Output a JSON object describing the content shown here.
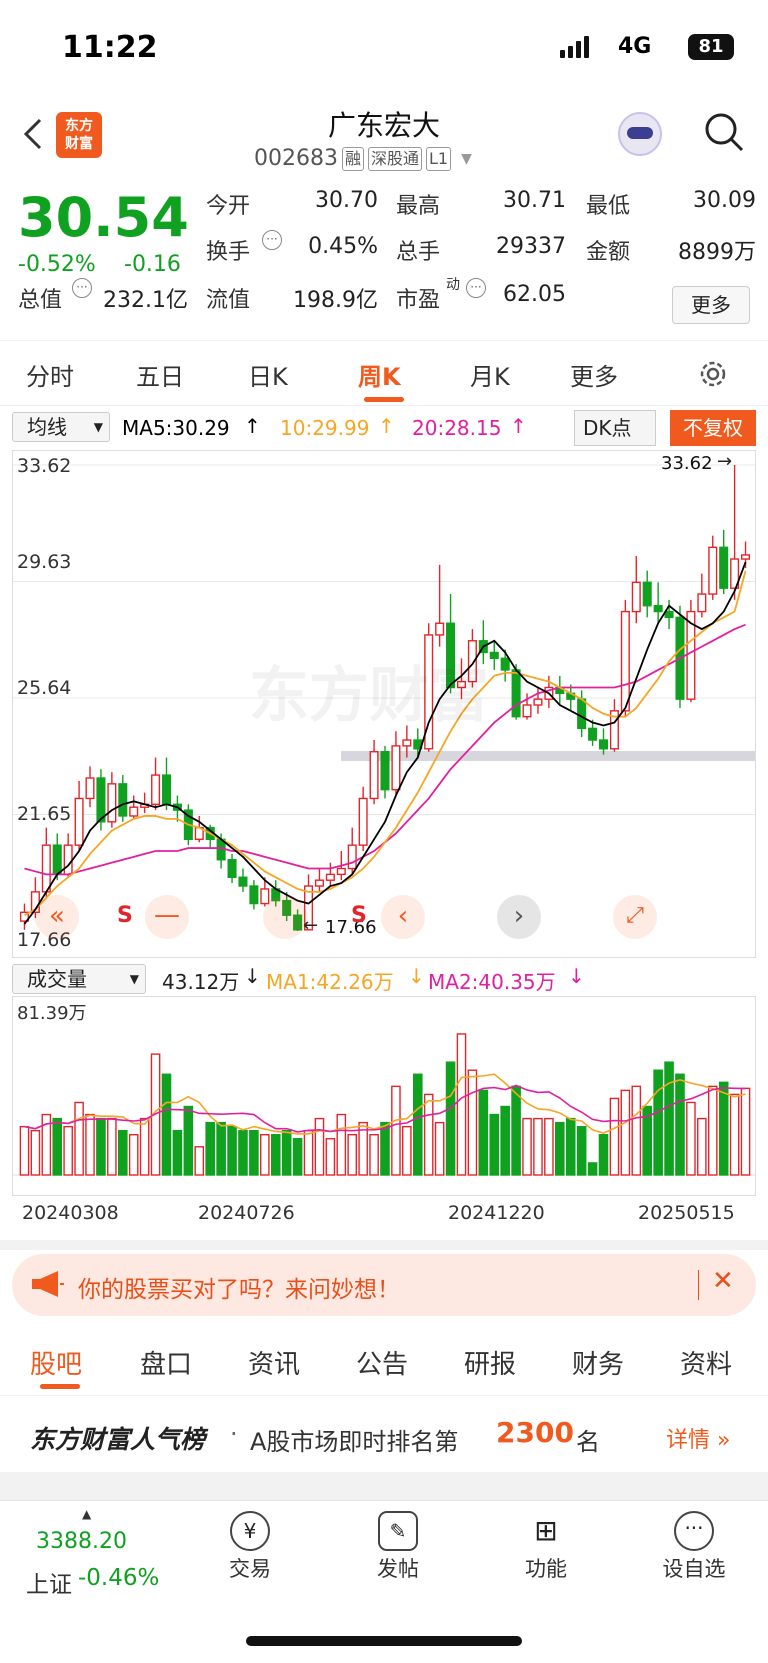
{
  "status": {
    "time": "11:22",
    "network": "4G",
    "battery": "81"
  },
  "header": {
    "logo": "东方财富",
    "title": "广东宏大",
    "code": "002683",
    "tags": [
      "融",
      "深股通",
      "L1"
    ]
  },
  "quote": {
    "price": "30.54",
    "change_pct": "-0.52%",
    "change": "-0.16",
    "open_label": "今开",
    "open": "30.70",
    "high_label": "最高",
    "high": "30.71",
    "low_label": "最低",
    "low": "30.09",
    "turnover_label": "换手",
    "turnover": "0.45%",
    "volume_label": "总手",
    "volume": "29337",
    "amount_label": "金额",
    "amount": "8899万",
    "mcap_label": "总值",
    "mcap": "232.1亿",
    "float_label": "流值",
    "float": "198.9亿",
    "pe_label": "市盈",
    "pe_sup": "动",
    "pe": "62.05",
    "more": "更多"
  },
  "tabs": [
    "分时",
    "五日",
    "日K",
    "周K",
    "月K",
    "更多"
  ],
  "chart_toolbar": {
    "select": "均线",
    "ma5": "MA5:30.29",
    "ma10": "10:29.99",
    "ma20": "20:28.15",
    "dk": "DK点",
    "fuquan": "不复权"
  },
  "kchart": {
    "y_labels": [
      "33.62",
      "29.63",
      "25.64",
      "21.65",
      "17.66"
    ],
    "max_mark": "33.62",
    "min_mark": "17.66",
    "watermark": "东方财富",
    "signals": [
      "S",
      "S"
    ]
  },
  "vol_toolbar": {
    "select": "成交量",
    "vol": "43.12万",
    "ma1": "MA1:42.26万",
    "ma2": "MA2:40.35万"
  },
  "vchart": {
    "max_label": "81.39万"
  },
  "dates": [
    "20240308",
    "20240726",
    "20241220",
    "20250515"
  ],
  "banner": {
    "text": "你的股票买对了吗？来问妙想！"
  },
  "bottom_tabs": [
    "股吧",
    "盘口",
    "资讯",
    "公告",
    "研报",
    "财务",
    "资料"
  ],
  "rank": {
    "brand": "东方财富人气榜",
    "text": "A股市场即时排名第",
    "num": "2300",
    "suffix": "名",
    "detail": "详情"
  },
  "bottom_nav": {
    "index_value": "3388.20",
    "index_name": "上证",
    "index_change": "-0.46%",
    "items": [
      "交易",
      "发帖",
      "功能",
      "设自选"
    ]
  },
  "colors": {
    "accent": "#f05a1e",
    "up": "#e3242b",
    "down": "#11a121",
    "ma5": "#000000",
    "ma10": "#f5a623",
    "ma20": "#e020a0"
  },
  "chart_data": {
    "type": "candlestick",
    "ylim": [
      17.66,
      33.62
    ],
    "candles": [
      [
        18.0,
        18.3,
        17.7,
        18.6
      ],
      [
        18.3,
        19.0,
        18.1,
        19.5
      ],
      [
        19.0,
        20.6,
        18.8,
        21.2
      ],
      [
        20.6,
        19.6,
        19.4,
        21.0
      ],
      [
        19.6,
        20.6,
        19.5,
        21.0
      ],
      [
        20.6,
        22.2,
        20.4,
        22.8
      ],
      [
        22.2,
        22.9,
        21.9,
        23.3
      ],
      [
        22.9,
        21.4,
        21.1,
        23.2
      ],
      [
        21.4,
        22.7,
        21.2,
        23.1
      ],
      [
        22.7,
        21.6,
        21.4,
        23.0
      ],
      [
        21.6,
        21.9,
        21.5,
        22.3
      ],
      [
        21.9,
        22.0,
        21.7,
        22.4
      ],
      [
        22.0,
        23.0,
        21.8,
        23.6
      ],
      [
        23.0,
        22.0,
        21.8,
        23.6
      ],
      [
        22.0,
        21.8,
        21.4,
        22.3
      ],
      [
        21.8,
        20.8,
        20.6,
        22.0
      ],
      [
        20.8,
        21.2,
        20.7,
        21.6
      ],
      [
        21.2,
        20.8,
        20.5,
        21.3
      ],
      [
        20.8,
        20.1,
        19.8,
        21.0
      ],
      [
        20.1,
        19.5,
        19.3,
        20.3
      ],
      [
        19.5,
        19.2,
        19.0,
        19.8
      ],
      [
        19.2,
        18.6,
        18.4,
        19.4
      ],
      [
        18.6,
        19.1,
        18.5,
        19.5
      ],
      [
        19.1,
        18.7,
        18.5,
        19.4
      ],
      [
        18.7,
        18.2,
        18.0,
        19.0
      ],
      [
        18.2,
        17.7,
        17.66,
        18.4
      ],
      [
        17.7,
        19.2,
        17.7,
        19.6
      ],
      [
        19.2,
        19.4,
        19.0,
        19.8
      ],
      [
        19.4,
        19.6,
        19.2,
        20.0
      ],
      [
        19.6,
        19.8,
        19.4,
        20.4
      ],
      [
        19.8,
        20.6,
        19.6,
        21.2
      ],
      [
        20.6,
        22.2,
        20.4,
        22.6
      ],
      [
        22.2,
        23.8,
        22.0,
        24.2
      ],
      [
        23.8,
        22.5,
        22.2,
        24.0
      ],
      [
        22.5,
        24.0,
        22.3,
        24.5
      ],
      [
        24.0,
        24.2,
        23.6,
        24.7
      ],
      [
        24.2,
        23.9,
        23.6,
        24.6
      ],
      [
        23.9,
        27.8,
        23.8,
        28.2
      ],
      [
        27.8,
        28.2,
        27.4,
        30.2
      ],
      [
        28.2,
        26.0,
        25.8,
        29.2
      ],
      [
        26.0,
        26.2,
        25.6,
        27.0
      ],
      [
        26.2,
        27.6,
        26.0,
        28.0
      ],
      [
        27.6,
        27.2,
        26.8,
        28.3
      ],
      [
        27.2,
        27.0,
        26.6,
        27.6
      ],
      [
        27.0,
        26.6,
        26.2,
        27.3
      ],
      [
        26.6,
        25.0,
        24.9,
        26.8
      ],
      [
        25.0,
        25.4,
        24.9,
        25.8
      ],
      [
        25.4,
        25.6,
        25.1,
        26.0
      ],
      [
        25.6,
        26.0,
        25.3,
        26.4
      ],
      [
        26.0,
        25.8,
        25.4,
        26.4
      ],
      [
        25.8,
        25.6,
        25.2,
        26.1
      ],
      [
        25.6,
        24.6,
        24.3,
        25.9
      ],
      [
        24.6,
        24.2,
        24.0,
        24.9
      ],
      [
        24.2,
        23.9,
        23.7,
        24.6
      ],
      [
        23.9,
        25.2,
        23.8,
        25.6
      ],
      [
        25.2,
        28.6,
        25.0,
        29.0
      ],
      [
        28.6,
        29.6,
        28.2,
        30.5
      ],
      [
        29.6,
        28.8,
        28.4,
        30.0
      ],
      [
        28.8,
        28.6,
        28.2,
        29.6
      ],
      [
        28.6,
        28.4,
        28.0,
        29.0
      ],
      [
        28.4,
        25.6,
        25.3,
        28.8
      ],
      [
        25.6,
        28.6,
        25.5,
        29.0
      ],
      [
        28.6,
        29.2,
        28.4,
        29.9
      ],
      [
        29.2,
        30.8,
        29.0,
        31.2
      ],
      [
        30.8,
        29.4,
        29.2,
        31.4
      ],
      [
        29.4,
        30.4,
        29.0,
        33.62
      ],
      [
        30.4,
        30.54,
        30.09,
        31.0
      ]
    ],
    "ma5": [
      17.9,
      18.4,
      19.0,
      19.6,
      19.9,
      20.4,
      21.1,
      21.5,
      21.8,
      22.0,
      22.1,
      22.0,
      21.9,
      22.0,
      21.9,
      21.6,
      21.4,
      21.1,
      20.8,
      20.5,
      20.2,
      19.8,
      19.4,
      19.1,
      18.9,
      18.7,
      18.6,
      18.9,
      19.2,
      19.3,
      19.6,
      20.2,
      20.8,
      21.4,
      22.3,
      23.1,
      23.6,
      24.8,
      25.6,
      26.1,
      26.4,
      26.8,
      27.4,
      27.6,
      27.2,
      26.6,
      26.2,
      26.0,
      25.8,
      25.4,
      25.2,
      25.0,
      24.8,
      24.7,
      24.8,
      25.3,
      26.3,
      27.3,
      28.2,
      28.8,
      28.5,
      28.2,
      28.0,
      28.2,
      28.6,
      29.3,
      30.29
    ],
    "ma10": [
      18.2,
      18.4,
      18.8,
      19.2,
      19.5,
      19.8,
      20.3,
      20.7,
      21.1,
      21.3,
      21.5,
      21.6,
      21.6,
      21.5,
      21.5,
      21.3,
      21.2,
      21.0,
      20.8,
      20.6,
      20.3,
      20.0,
      19.7,
      19.5,
      19.3,
      19.1,
      19.0,
      19.0,
      19.1,
      19.3,
      19.5,
      19.8,
      20.2,
      20.7,
      21.2,
      21.8,
      22.4,
      23.1,
      23.8,
      24.5,
      25.1,
      25.6,
      26.0,
      26.4,
      26.5,
      26.5,
      26.4,
      26.3,
      26.2,
      26.0,
      25.8,
      25.6,
      25.3,
      25.1,
      25.0,
      25.0,
      25.3,
      25.8,
      26.3,
      26.9,
      27.3,
      27.6,
      27.9,
      28.2,
      28.4,
      28.6,
      29.99
    ],
    "ma20": [
      19.8,
      19.7,
      19.6,
      19.6,
      19.6,
      19.7,
      19.8,
      19.9,
      20.0,
      20.1,
      20.2,
      20.3,
      20.4,
      20.4,
      20.4,
      20.5,
      20.5,
      20.5,
      20.5,
      20.4,
      20.4,
      20.3,
      20.2,
      20.1,
      20.0,
      19.9,
      19.8,
      19.8,
      19.8,
      19.9,
      20.0,
      20.2,
      20.4,
      20.7,
      21.0,
      21.4,
      21.8,
      22.2,
      22.7,
      23.2,
      23.6,
      24.0,
      24.4,
      24.8,
      25.1,
      25.4,
      25.6,
      25.8,
      25.9,
      26.0,
      26.0,
      26.0,
      26.0,
      26.0,
      26.0,
      26.1,
      26.2,
      26.4,
      26.6,
      26.8,
      27.0,
      27.2,
      27.4,
      27.6,
      27.8,
      28.0,
      28.15
    ],
    "volumes": [
      24,
      22,
      30,
      28,
      24,
      36,
      30,
      28,
      28,
      22,
      20,
      28,
      60,
      50,
      22,
      34,
      14,
      26,
      26,
      24,
      22,
      22,
      20,
      20,
      22,
      18,
      22,
      28,
      18,
      30,
      20,
      26,
      20,
      26,
      44,
      24,
      50,
      40,
      26,
      56,
      70,
      52,
      42,
      30,
      34,
      44,
      28,
      28,
      28,
      26,
      28,
      24,
      6,
      20,
      38,
      42,
      44,
      34,
      52,
      56,
      50,
      36,
      28,
      44,
      46,
      40,
      43
    ]
  }
}
